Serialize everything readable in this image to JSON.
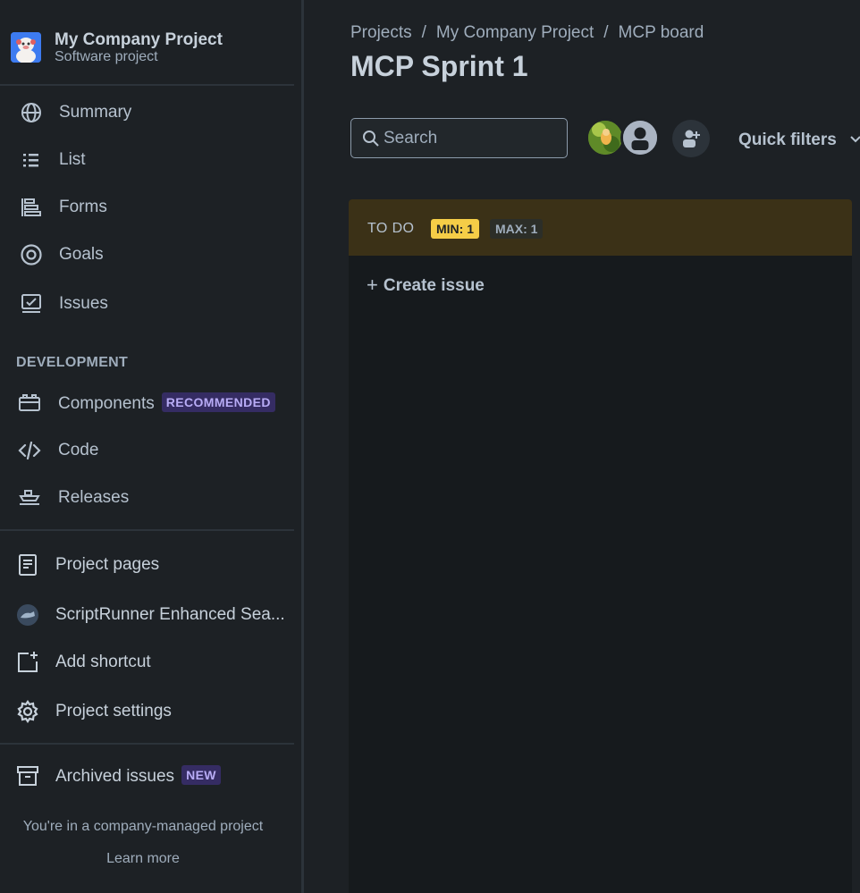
{
  "project": {
    "name": "My Company Project",
    "type": "Software project"
  },
  "nav": {
    "summary": "Summary",
    "list": "List",
    "forms": "Forms",
    "goals": "Goals",
    "issues": "Issues"
  },
  "development": {
    "title": "DEVELOPMENT",
    "components": "Components",
    "components_badge": "RECOMMENDED",
    "code": "Code",
    "releases": "Releases"
  },
  "shortcuts": {
    "project_pages": "Project pages",
    "scriptrunner": "ScriptRunner Enhanced Sea...",
    "add_shortcut": "Add shortcut",
    "project_settings": "Project settings"
  },
  "archived": {
    "label": "Archived issues",
    "badge": "NEW"
  },
  "footer": {
    "text": "You're in a company-managed project",
    "link": "Learn more"
  },
  "breadcrumb": [
    "Projects",
    "My Company Project",
    "MCP board"
  ],
  "page_title": "MCP Sprint 1",
  "search": {
    "placeholder": "Search",
    "value": ""
  },
  "quick_filters": "Quick filters",
  "column": {
    "title": "TO DO",
    "min": "MIN: 1",
    "max": "MAX: 1",
    "create_issue": "Create issue"
  },
  "colors": {
    "background": "#1d2125",
    "column_header": "#3b3117",
    "min_lozenge": "#f5cd47",
    "badge_purple": "#b8acf6"
  }
}
